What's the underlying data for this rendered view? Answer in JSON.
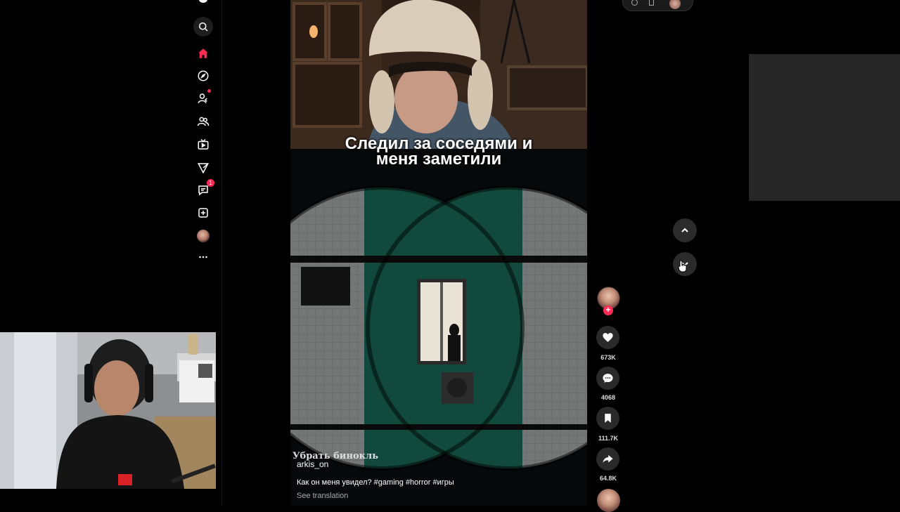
{
  "sidebar": {
    "nav_items": [
      {
        "name": "search-icon"
      },
      {
        "name": "home-icon",
        "active": true
      },
      {
        "name": "explore-icon"
      },
      {
        "name": "following-icon",
        "dot": true
      },
      {
        "name": "friends-icon"
      },
      {
        "name": "live-icon"
      },
      {
        "name": "messages-send-icon"
      },
      {
        "name": "inbox-icon",
        "badge": "1"
      },
      {
        "name": "upload-icon"
      },
      {
        "name": "profile-avatar"
      },
      {
        "name": "more-icon"
      }
    ],
    "inbox_badge": "1"
  },
  "video": {
    "caption_line1": "Следил за соседями и",
    "caption_line2": "меня заметили",
    "game_text": "Убрать бинокль",
    "author": "arkis_on",
    "description": "Как он меня увидел?",
    "hashtags": [
      "#gaming",
      "#horror",
      "#игры"
    ],
    "see_translation": "See translation"
  },
  "actions": {
    "likes": "673K",
    "comments": "4068",
    "saves": "111.7K",
    "shares": "64.8K",
    "follow_plus": "+"
  },
  "colors": {
    "accent": "#fe2c55",
    "background": "#000000",
    "button_bg": "#2a2a2a"
  }
}
